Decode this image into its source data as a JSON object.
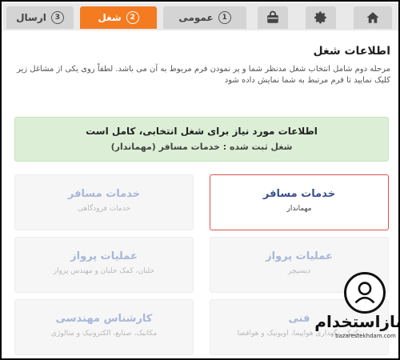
{
  "tabs": {
    "send": {
      "number": "3",
      "label": "ارسال"
    },
    "job": {
      "number": "2",
      "label": "شغل"
    },
    "general": {
      "number": "1",
      "label": "عمومی"
    },
    "lock_icon": "lock-icon",
    "gear_icon": "gear-icon",
    "home_icon": "home-icon"
  },
  "page": {
    "title": "اطلاعات شغل",
    "description": "مرحله دوم شامل انتخاب شغل مدنظر شما و پر نمودن فرم مربوط به آن می باشد. لطفاً روی یکی از مشاغل زیر کلیک نمایید تا فرم مرتبط به شما نمایش داده شود"
  },
  "alert": {
    "line1": "اطلاعات مورد نیاز برای شغل انتخابی، کامل است",
    "line2": "شغل ثبت شده : خدمات مسافر (مهماندار)"
  },
  "cards": [
    {
      "title": "خدمات مسافر",
      "subtitle": "مهماندار",
      "selected": true
    },
    {
      "title": "خدمات مسافر",
      "subtitle": "خدمات فرودگاهی",
      "selected": false
    },
    {
      "title": "عملیات پرواز",
      "subtitle": "دیسپچر",
      "selected": false
    },
    {
      "title": "عملیات پرواز",
      "subtitle": "خلبان، کمک خلبان و مهندس پرواز",
      "selected": false
    },
    {
      "title": "فنی",
      "subtitle": "تکنیک، نگهداری هواپیما، اویونیک و هوافضا",
      "selected": false
    },
    {
      "title": "کارشناس مهندسی",
      "subtitle": "مکانیک، صنایع، الکترونیک و متالوژی",
      "selected": false
    }
  ],
  "watermark": {
    "brand": "بازاستخدام",
    "url": "bazarestekhdam.com"
  },
  "colors": {
    "accent": "#f47b20",
    "success_bg": "#dcefd6",
    "selected_border": "#d9534f"
  }
}
